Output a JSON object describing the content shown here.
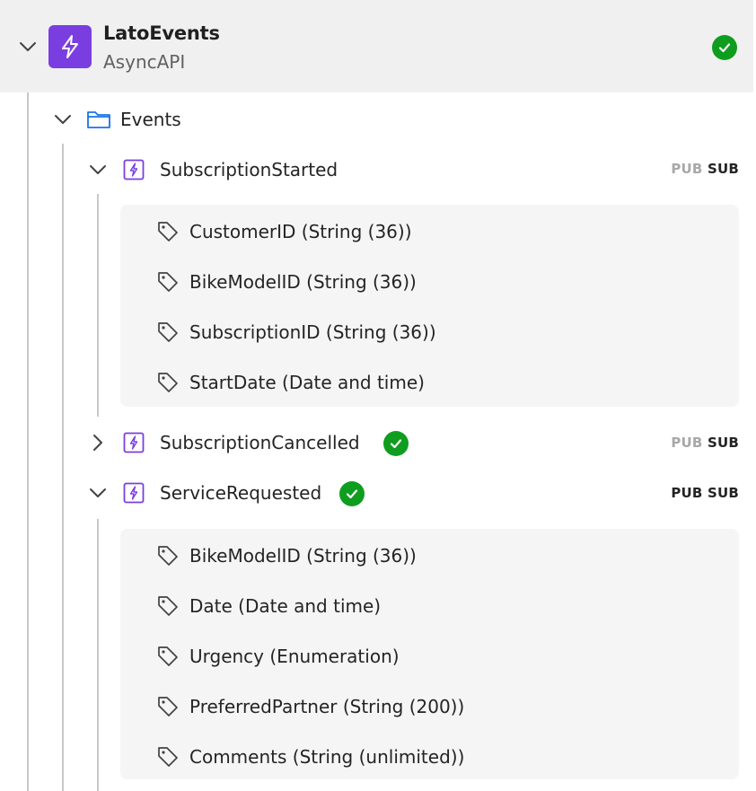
{
  "app": {
    "title": "LatoEvents",
    "subtitle": "AsyncAPI",
    "accent": "#7a3ee0",
    "status_color": "#0f9d1f"
  },
  "folder": {
    "label": "Events",
    "icon": "folder-icon"
  },
  "events": [
    {
      "name": "SubscriptionStarted",
      "expanded": true,
      "valid": false,
      "pub": "PUB",
      "sub": "SUB",
      "pub_active": false,
      "attributes": [
        "CustomerID (String (36))",
        "BikeModelID (String (36))",
        "SubscriptionID (String (36))",
        "StartDate (Date and time)"
      ]
    },
    {
      "name": "SubscriptionCancelled",
      "expanded": false,
      "valid": true,
      "pub": "PUB",
      "sub": "SUB",
      "pub_active": false,
      "attributes": []
    },
    {
      "name": "ServiceRequested",
      "expanded": true,
      "valid": true,
      "pub": "PUB",
      "sub": "SUB",
      "pub_active": true,
      "attributes": [
        "BikeModelID (String (36))",
        "Date (Date and time)",
        "Urgency (Enumeration)",
        "PreferredPartner (String (200))",
        "Comments (String (unlimited))"
      ]
    }
  ]
}
